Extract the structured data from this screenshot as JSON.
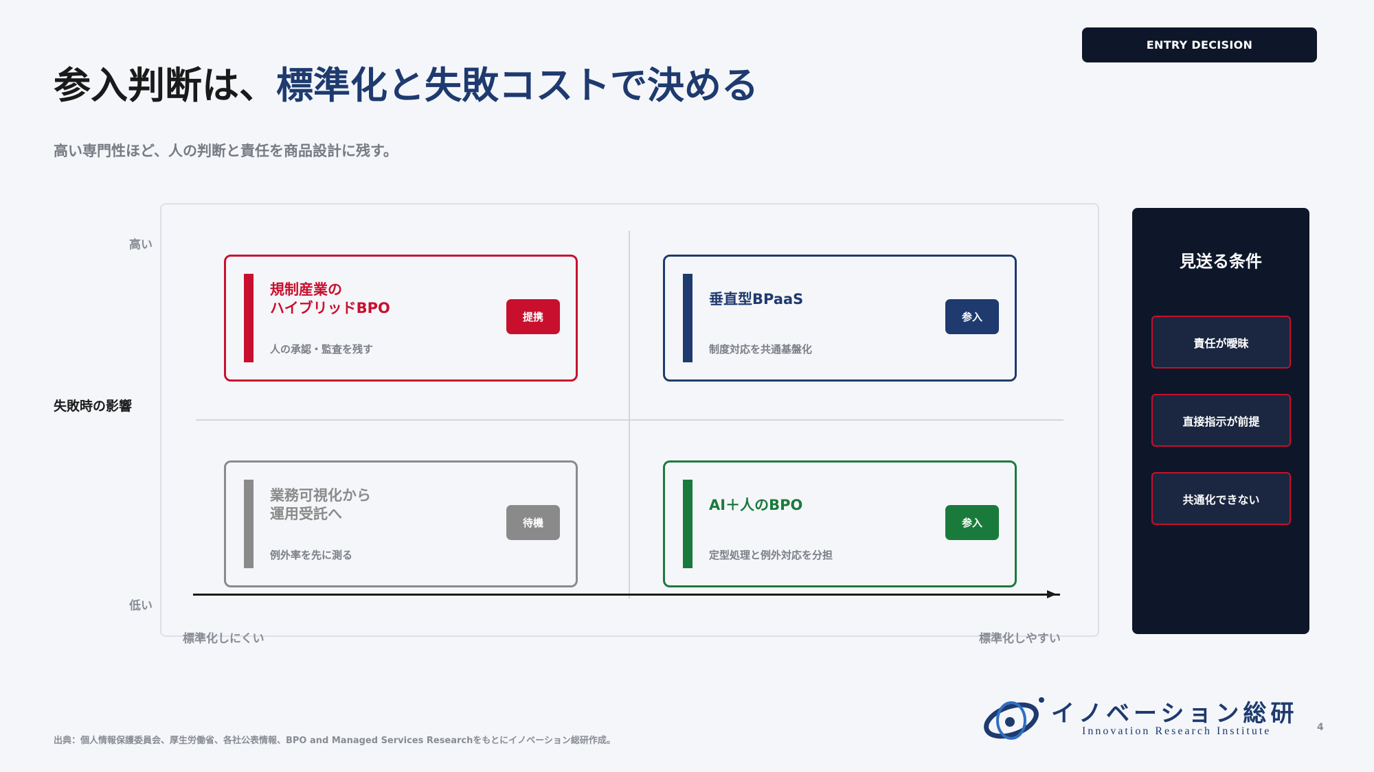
{
  "badge": "ENTRY DECISION",
  "title": {
    "main": "参入判断は、",
    "accent": "標準化と失敗コストで決める"
  },
  "subtitle": "高い専門性ほど、人の判断と責任を商品設計に残す。",
  "axes": {
    "y_title": "失敗時の影響",
    "y_high": "高い",
    "y_low": "低い",
    "x_left": "標準化しにくい",
    "x_right": "標準化しやすい"
  },
  "quadrants": [
    {
      "title": "規制産業の\nハイブリッドBPO",
      "sub": "人の承認・監査を残す",
      "action": "提携",
      "color": "#c8102e"
    },
    {
      "title": "垂直型BPaaS",
      "sub": "制度対応を共通基盤化",
      "action": "参入",
      "color": "#1e3a6e"
    },
    {
      "title": "業務可視化から\n運用受託へ",
      "sub": "例外率を先に測る",
      "action": "待機",
      "color": "#8a8a8a"
    },
    {
      "title": "AI＋人のBPO",
      "sub": "定型処理と例外対応を分担",
      "action": "参入",
      "color": "#1a7a3c"
    }
  ],
  "side_panel": {
    "title": "見送る条件",
    "items": [
      "責任が曖昧",
      "直接指示が前提",
      "共通化できない"
    ]
  },
  "logo": {
    "name": "イノベーション総研",
    "sub": "Innovation Research Institute"
  },
  "page_number": "4",
  "source": "出典：個人情報保護委員会、厚生労働省、各社公表情報、BPO and Managed Services Researchをもとにイノベーション総研作成。"
}
